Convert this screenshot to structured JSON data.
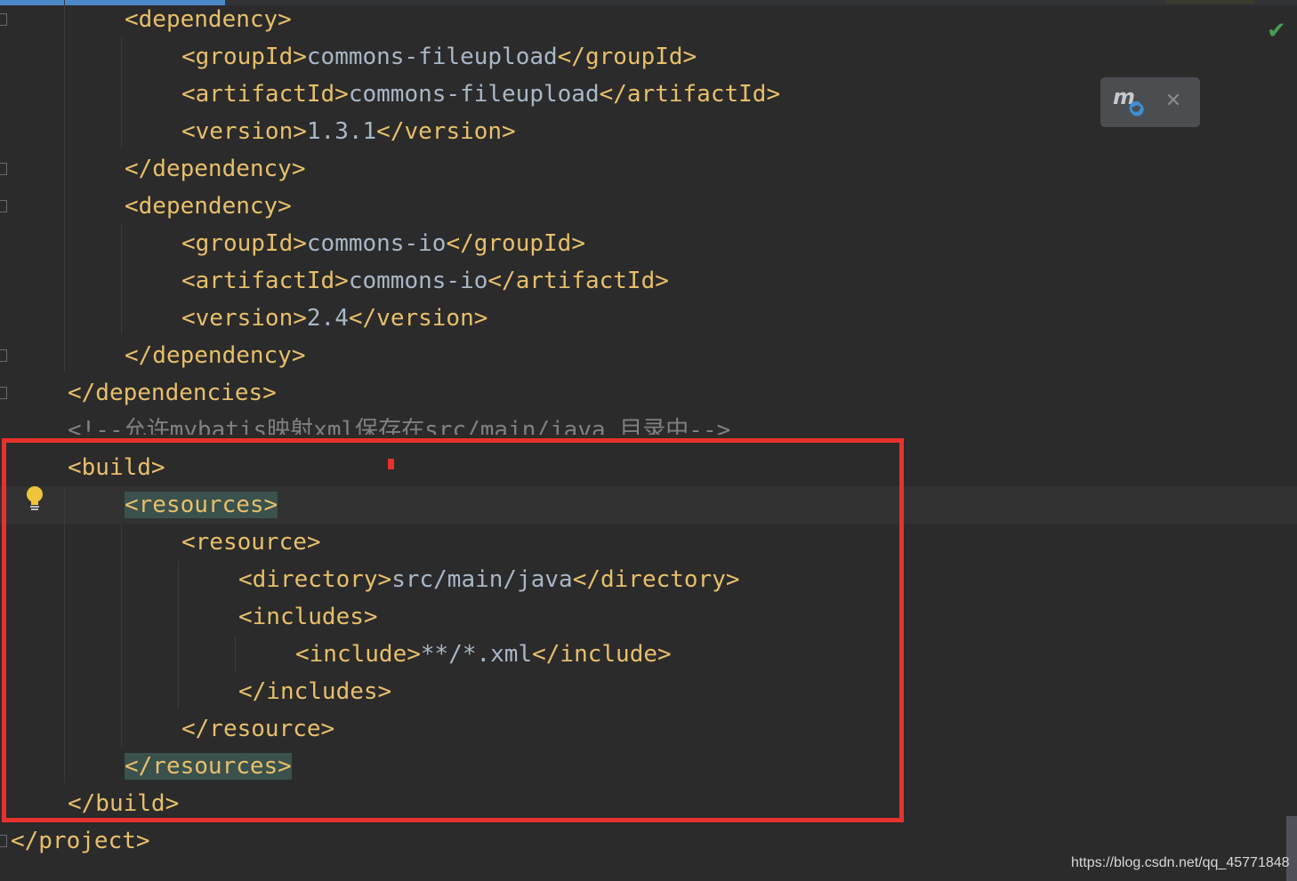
{
  "editor": {
    "lines": [
      {
        "parts": [
          {
            "t": "tag",
            "text": "<dependency>"
          }
        ]
      },
      {
        "parts": [
          {
            "t": "tag",
            "text": "<groupId>"
          },
          {
            "t": "val",
            "text": "commons-fileupload"
          },
          {
            "t": "tag",
            "text": "</groupId>"
          }
        ]
      },
      {
        "parts": [
          {
            "t": "tag",
            "text": "<artifactId>"
          },
          {
            "t": "val",
            "text": "commons-fileupload"
          },
          {
            "t": "tag",
            "text": "</artifactId>"
          }
        ]
      },
      {
        "parts": [
          {
            "t": "tag",
            "text": "<version>"
          },
          {
            "t": "val",
            "text": "1.3.1"
          },
          {
            "t": "tag",
            "text": "</version>"
          }
        ]
      },
      {
        "parts": [
          {
            "t": "tag",
            "text": "</dependency>"
          }
        ]
      },
      {
        "parts": [
          {
            "t": "tag",
            "text": "<dependency>"
          }
        ]
      },
      {
        "parts": [
          {
            "t": "tag",
            "text": "<groupId>"
          },
          {
            "t": "val",
            "text": "commons-io"
          },
          {
            "t": "tag",
            "text": "</groupId>"
          }
        ]
      },
      {
        "parts": [
          {
            "t": "tag",
            "text": "<artifactId>"
          },
          {
            "t": "val",
            "text": "commons-io"
          },
          {
            "t": "tag",
            "text": "</artifactId>"
          }
        ]
      },
      {
        "parts": [
          {
            "t": "tag",
            "text": "<version>"
          },
          {
            "t": "val",
            "text": "2.4"
          },
          {
            "t": "tag",
            "text": "</version>"
          }
        ]
      },
      {
        "parts": [
          {
            "t": "tag",
            "text": "</dependency>"
          }
        ]
      },
      {
        "parts": [
          {
            "t": "tag",
            "text": "</dependencies>"
          }
        ]
      },
      {
        "parts": [
          {
            "t": "cmt",
            "text": "<!--允许mybatis映射xml保存在src/main/java 目录中-->"
          }
        ]
      },
      {
        "parts": [
          {
            "t": "tag",
            "text": "<build>"
          }
        ]
      },
      {
        "parts": [
          {
            "t": "tag",
            "text": "<resources>",
            "match": true
          }
        ]
      },
      {
        "parts": [
          {
            "t": "tag",
            "text": "<resource>"
          }
        ]
      },
      {
        "parts": [
          {
            "t": "tag",
            "text": "<directory>"
          },
          {
            "t": "val",
            "text": "src/main/java"
          },
          {
            "t": "tag",
            "text": "</directory>"
          }
        ]
      },
      {
        "parts": [
          {
            "t": "tag",
            "text": "<includes>"
          }
        ]
      },
      {
        "parts": [
          {
            "t": "tag",
            "text": "<include>"
          },
          {
            "t": "val",
            "text": "**/*.xml"
          },
          {
            "t": "tag",
            "text": "</include>"
          }
        ]
      },
      {
        "parts": [
          {
            "t": "tag",
            "text": "</includes>"
          }
        ]
      },
      {
        "parts": [
          {
            "t": "tag",
            "text": "</resource>"
          }
        ]
      },
      {
        "parts": [
          {
            "t": "tag",
            "text": "</resources>",
            "match": true
          }
        ]
      },
      {
        "parts": [
          {
            "t": "tag",
            "text": "</build>"
          }
        ]
      },
      {
        "parts": [
          {
            "t": "tag",
            "text": "</project>"
          }
        ]
      }
    ]
  },
  "maven_popup": {
    "icon": "maven-reload-icon",
    "close_icon": "close-icon",
    "close_glyph": "✕"
  },
  "inspection": {
    "icon": "check-icon",
    "glyph": "✔",
    "color": "#499c54"
  },
  "intention": {
    "icon": "lightbulb-icon"
  },
  "highlight": {
    "color": "#e8312d"
  },
  "watermark": "https://blog.csdn.net/qq_45771848"
}
